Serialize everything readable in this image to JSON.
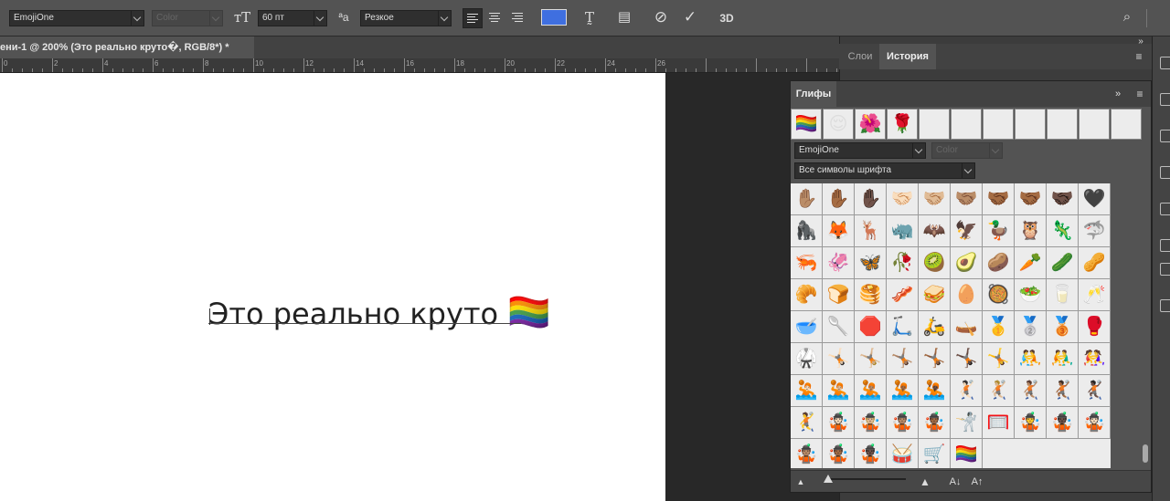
{
  "options_bar": {
    "font_family": "EmojiOne",
    "font_style": "Color",
    "font_size": "60 пт",
    "antialias": "Резкое",
    "text_color": "#3f6fe0",
    "label_3d": "3D"
  },
  "document": {
    "tab_title": "ени-1 @ 200% (Это реально круто�, RGB/8*) *",
    "ruler_numbers": [
      "0",
      "2",
      "4",
      "6",
      "8",
      "10",
      "12",
      "14",
      "16",
      "18",
      "20",
      "22",
      "24",
      "26"
    ],
    "canvas_text": "Это реально круто",
    "canvas_emoji": "🏳️‍🌈"
  },
  "panels": {
    "tabs": [
      {
        "label": "Слои",
        "active": false
      },
      {
        "label": "История",
        "active": true
      }
    ]
  },
  "glyphs_panel": {
    "title": "Глифы",
    "recent_glyphs": [
      "🏳️‍🌈",
      "😌",
      "🌺",
      "🌹"
    ],
    "font_family": "EmojiOne",
    "font_style": "Color",
    "subset": "Все символы шрифта",
    "grid_rows": [
      [
        "✋🏽",
        "✋🏾",
        "✋🏿",
        "🤝🏻",
        "🤝🏼",
        "🤝🏽",
        "🤝🏾",
        "🤝🏾",
        "🤝🏿",
        "🖤"
      ],
      [
        "🦍",
        "🦊",
        "🦌",
        "🦏",
        "🦇",
        "🦅",
        "🦆",
        "🦉",
        "🦎",
        "🦈"
      ],
      [
        "🦐",
        "🦑",
        "🦋",
        "🥀",
        "🥝",
        "🥑",
        "🥔",
        "🥕",
        "🥒",
        "🥜"
      ],
      [
        "🥐",
        "🍞",
        "🥞",
        "🥓",
        "🥪",
        "🥚",
        "🥘",
        "🥗",
        "🥛",
        "🥂"
      ],
      [
        "🥣",
        "🥄",
        "🛑",
        "🛴",
        "🛵",
        "🛶",
        "🥇",
        "🥈",
        "🥉",
        "🥊"
      ],
      [
        "🥋",
        "🤸🏻",
        "🤸🏼",
        "🤸🏽",
        "🤸🏾",
        "🤸🏿",
        "🤸",
        "🤼",
        "🤼‍♂️",
        "🤼‍♀️"
      ],
      [
        "🤽🏻",
        "🤽🏼",
        "🤽🏽",
        "🤽🏾",
        "🤽🏿",
        "🤾🏻",
        "🤾🏼",
        "🤾🏽",
        "🤾🏾",
        "🤾🏿"
      ],
      [
        "🤾",
        "🤹🏻",
        "🤹🏼",
        "🤹🏽",
        "🤹🏾",
        "🤺",
        "🥅",
        "🤹",
        "🤹🏿",
        "🤹🏻"
      ],
      [
        "🤹🏽",
        "🤹🏾",
        "🤹🏿",
        "🥁",
        "🛒",
        "🏳️‍🌈"
      ]
    ]
  }
}
